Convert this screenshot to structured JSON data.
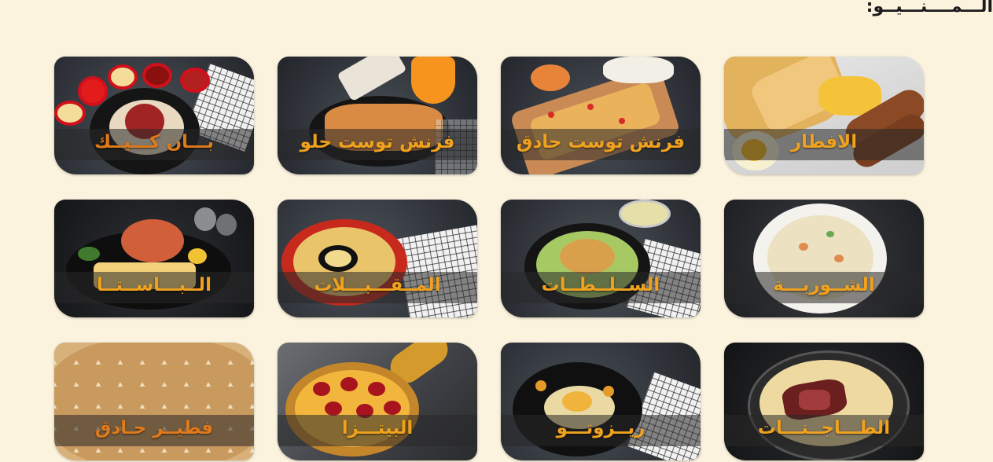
{
  "page": {
    "heading": "الـــمــــنـــيــو:"
  },
  "categories": [
    {
      "label": "الافطار",
      "image_icon": "breakfast-image",
      "style": "breakfast"
    },
    {
      "label": "فرنش توست حادق",
      "image_icon": "savory-french-toast-image",
      "style": "savory-toast"
    },
    {
      "label": "فرنش توست حلو",
      "image_icon": "sweet-french-toast-image",
      "style": "sweet-toast"
    },
    {
      "label": "بـــان كـــيــك",
      "image_icon": "pancake-image",
      "style": "pancake"
    },
    {
      "label": "الشــوربـــة",
      "image_icon": "soup-image",
      "style": "soup"
    },
    {
      "label": "الســلــطــات",
      "image_icon": "salad-image",
      "style": "salad"
    },
    {
      "label": "المــقـــبـــلات",
      "image_icon": "appetizers-image",
      "style": "appetizers"
    },
    {
      "label": "الــبـــاســتــا",
      "image_icon": "pasta-image",
      "style": "pasta"
    },
    {
      "label": "الطـــاجــنـــات",
      "image_icon": "tajine-image",
      "style": "tajine"
    },
    {
      "label": "ريــزوتـــو",
      "image_icon": "risotto-image",
      "style": "risotto"
    },
    {
      "label": "البيتـــزا",
      "image_icon": "pizza-image",
      "style": "pizza"
    },
    {
      "label": "فطيــر حـادق",
      "image_icon": "savory-pie-image",
      "style": "pie"
    }
  ],
  "colors": {
    "page_background": "#fbf3de",
    "label_orange": "#f0a21e",
    "heading_text": "#1b1b1b"
  }
}
